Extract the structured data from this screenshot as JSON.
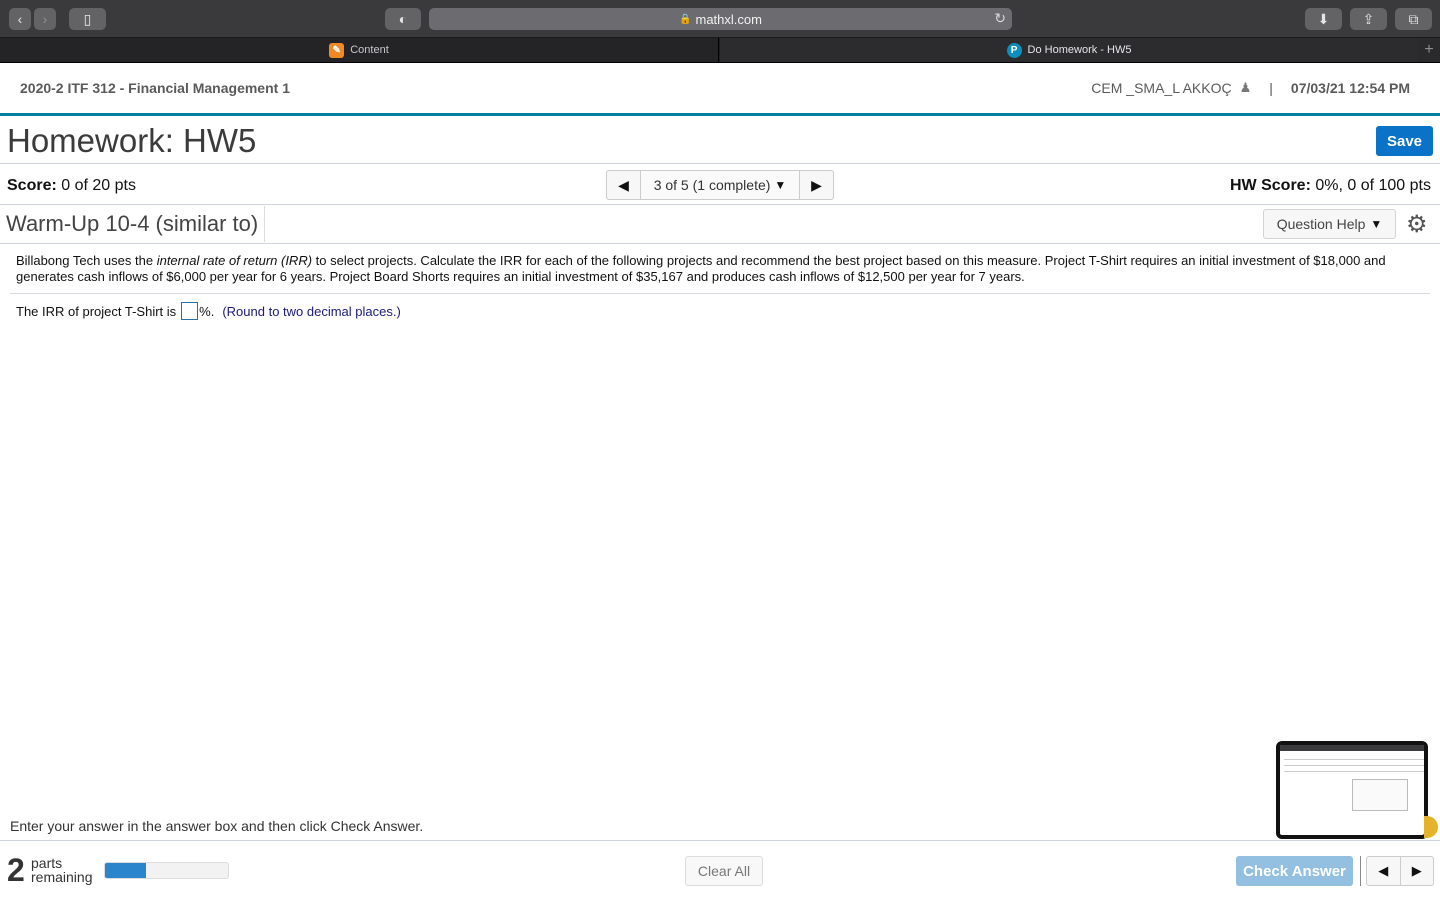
{
  "browser": {
    "url": "mathxl.com",
    "tabs": [
      {
        "label": "Content",
        "icon": "pencil-icon",
        "active": false
      },
      {
        "label": "Do Homework - HW5",
        "icon": "pearson-icon",
        "active": true
      }
    ],
    "icons": {
      "back": "‹",
      "forward": "›",
      "sidebar": "▯",
      "shield": "◐",
      "lock": "🔒",
      "reload": "↻",
      "download": "⬇",
      "share": "⇪",
      "tabs": "⧉",
      "new_tab": "+"
    }
  },
  "header": {
    "course": "2020-2 ITF 312 - Financial Management 1",
    "user": "CEM _SMA_L AKKOÇ",
    "separator": "|",
    "datetime": "07/03/21 12:54 PM"
  },
  "homework": {
    "title": "Homework: HW5",
    "save_label": "Save",
    "score_label": "Score:",
    "score_value": "0 of 20 pts",
    "nav_text": "3 of 5 (1 complete)",
    "hw_score_label": "HW Score:",
    "hw_score_value": "0%, 0 of 100 pts"
  },
  "question": {
    "title": "Warm-Up 10-4 (similar to)",
    "help_label": "Question Help",
    "problem_part1": "Billabong Tech uses the ",
    "problem_italic": "internal rate of return (IRR)",
    "problem_part2": " to select projects.  Calculate the IRR for each of the following projects and recommend the best project based on this measure.  Project T-Shirt requires an initial investment of $18,000 and generates cash inflows of $6,000 per year for 6 years.  Project Board Shorts requires an initial investment of $35,167 and produces cash inflows of $12,500 per year for 7 years.",
    "answer_prefix": "The IRR of project T-Shirt is",
    "answer_value": "",
    "answer_suffix": "%.",
    "hint": "(Round to two decimal places.)"
  },
  "footer": {
    "instruction": "Enter your answer in the answer box and then click Check Answer.",
    "parts_remaining": "2",
    "parts_label_1": "parts",
    "parts_label_2": "remaining",
    "progress_percent": 33,
    "clear_label": "Clear All",
    "check_label": "Check Answer"
  }
}
